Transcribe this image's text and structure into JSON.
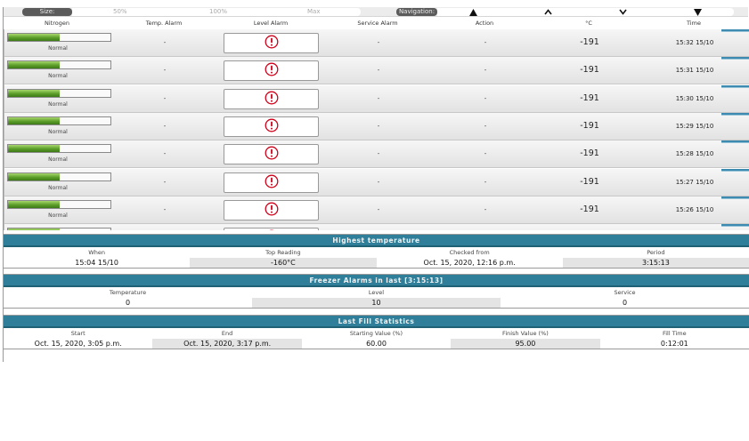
{
  "toolbar": {
    "size_label": "Size:",
    "size_ticks": [
      "50%",
      "100%",
      "Max"
    ],
    "nav_label": "Navigation:",
    "nav_buttons": [
      {
        "icon": "triangle-up-icon",
        "glyph": "▲"
      },
      {
        "icon": "chevron-up-icon",
        "glyph": "^"
      },
      {
        "icon": "chevron-down-icon",
        "glyph": "v"
      },
      {
        "icon": "triangle-down-icon",
        "glyph": "▼"
      }
    ]
  },
  "columns": {
    "nitrogen": "Nitrogen",
    "temp_alarm": "Temp. Alarm",
    "level_alarm": "Level Alarm",
    "service_alarm": "Service Alarm",
    "action": "Action",
    "temp": "°C",
    "time": "Time"
  },
  "rows": [
    {
      "level_fraction": 0.5,
      "status": "Normal",
      "temp_alarm": "-",
      "level_alarm_icon": "exclamation-circle-icon",
      "service_alarm": "-",
      "action": "-",
      "temp": "-191",
      "time": "15:32 15/10"
    },
    {
      "level_fraction": 0.5,
      "status": "Normal",
      "temp_alarm": "-",
      "level_alarm_icon": "exclamation-circle-icon",
      "service_alarm": "-",
      "action": "-",
      "temp": "-191",
      "time": "15:31 15/10"
    },
    {
      "level_fraction": 0.5,
      "status": "Normal",
      "temp_alarm": "-",
      "level_alarm_icon": "exclamation-circle-icon",
      "service_alarm": "-",
      "action": "-",
      "temp": "-191",
      "time": "15:30 15/10"
    },
    {
      "level_fraction": 0.5,
      "status": "Normal",
      "temp_alarm": "-",
      "level_alarm_icon": "exclamation-circle-icon",
      "service_alarm": "-",
      "action": "-",
      "temp": "-191",
      "time": "15:29 15/10"
    },
    {
      "level_fraction": 0.5,
      "status": "Normal",
      "temp_alarm": "-",
      "level_alarm_icon": "exclamation-circle-icon",
      "service_alarm": "-",
      "action": "-",
      "temp": "-191",
      "time": "15:28 15/10"
    },
    {
      "level_fraction": 0.5,
      "status": "Normal",
      "temp_alarm": "-",
      "level_alarm_icon": "exclamation-circle-icon",
      "service_alarm": "-",
      "action": "-",
      "temp": "-191",
      "time": "15:27 15/10"
    },
    {
      "level_fraction": 0.5,
      "status": "Normal",
      "temp_alarm": "-",
      "level_alarm_icon": "exclamation-circle-icon",
      "service_alarm": "-",
      "action": "-",
      "temp": "-191",
      "time": "15:26 15/10"
    },
    {
      "level_fraction": 0.5,
      "status": "",
      "temp_alarm": "",
      "level_alarm_icon": "exclamation-circle-icon",
      "service_alarm": "",
      "action": "",
      "temp": "",
      "time": ""
    }
  ],
  "highest_temperature": {
    "title": "Highest temperature",
    "labels": [
      "When",
      "Top Reading",
      "Checked from",
      "Period"
    ],
    "values": [
      "15:04 15/10",
      "-160°C",
      "Oct. 15, 2020, 12:16 p.m.",
      "3:15:13"
    ]
  },
  "freezer_alarms": {
    "title": "Freezer Alarms in last [3:15:13]",
    "labels": [
      "Temperature",
      "Level",
      "Service"
    ],
    "values": [
      "0",
      "10",
      "0"
    ]
  },
  "last_fill": {
    "title": "Last Fill Statistics",
    "labels": [
      "Start",
      "End",
      "Starting Value (%)",
      "Finish Value (%)",
      "Fill Time"
    ],
    "values": [
      "Oct. 15, 2020, 3:05 p.m.",
      "Oct. 15, 2020, 3:17 p.m.",
      "60.00",
      "95.00",
      "0:12:01"
    ]
  },
  "colors": {
    "panel_header": "#2f7f9a",
    "level_green": "#5b9e2a",
    "alarm_red": "#d0021b",
    "row_tab": "#3d8bb0"
  }
}
